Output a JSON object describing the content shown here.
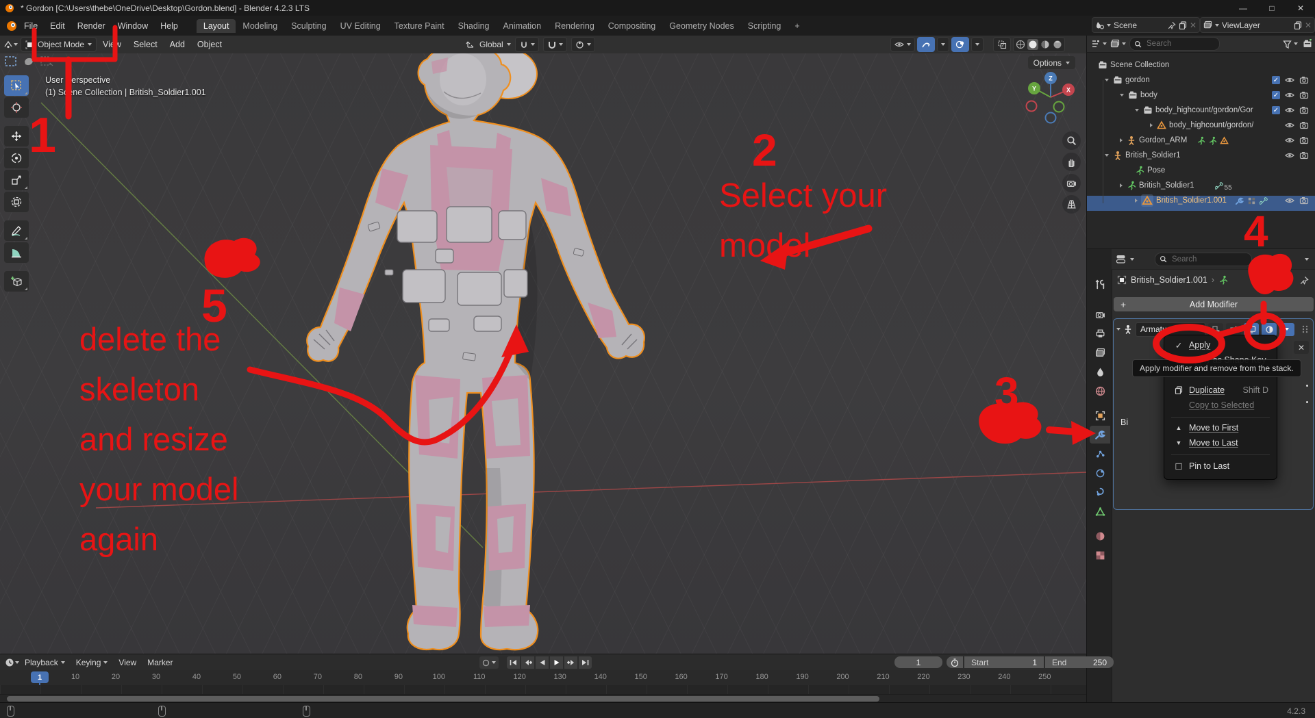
{
  "window": {
    "title": "* Gordon [C:\\Users\\thebe\\OneDrive\\Desktop\\Gordon.blend] - Blender 4.2.3 LTS",
    "minimize": "—",
    "maximize": "□",
    "close": "✕"
  },
  "menubar": {
    "menus": [
      "File",
      "Edit",
      "Render",
      "Window",
      "Help"
    ],
    "workspaces": [
      "Layout",
      "Modeling",
      "Sculpting",
      "UV Editing",
      "Texture Paint",
      "Shading",
      "Animation",
      "Rendering",
      "Compositing",
      "Geometry Nodes",
      "Scripting"
    ],
    "add_workspace": "+",
    "scene_value": "Scene",
    "viewlayer_value": "ViewLayer"
  },
  "viewport": {
    "mode": "Object Mode",
    "menus": [
      "View",
      "Select",
      "Add",
      "Object"
    ],
    "orientation": "Global",
    "options_label": "Options",
    "view_label": "User Perspective",
    "context_label": "(1) Scene Collection | British_Soldier1.001",
    "axis": {
      "x": "X",
      "y": "Y",
      "z": "Z"
    }
  },
  "outliner": {
    "search_placeholder": "Search",
    "rows": [
      {
        "label": "Scene Collection"
      },
      {
        "label": "gordon"
      },
      {
        "label": "body"
      },
      {
        "label": "body_highcount/gordon/Gor"
      },
      {
        "label": "body_highcount/gordon/"
      },
      {
        "label": "Gordon_ARM"
      },
      {
        "label": "British_Soldier1"
      },
      {
        "label": "Pose"
      },
      {
        "label": "British_Soldier1",
        "badge": "55"
      },
      {
        "label": "British_Soldier1.001"
      }
    ]
  },
  "properties": {
    "search_placeholder": "Search",
    "breadcrumb": "British_Soldier1.001",
    "add_modifier": "Add Modifier",
    "modifier_name": "Armature",
    "object_field_partial": "Bi",
    "close_glyph": "✕",
    "menu": {
      "apply": {
        "icon": "✓",
        "label": "Apply"
      },
      "apply_shape_key": {
        "label": "Apply as Shape Key"
      },
      "duplicate": {
        "label": "Duplicate",
        "shortcut": "Shift D"
      },
      "copy_to_selected": {
        "label": "Copy to Selected"
      },
      "move_first": {
        "icon": "▲",
        "label": "Move to First"
      },
      "move_last": {
        "icon": "▼",
        "label": "Move to Last"
      },
      "pin_last": {
        "icon": "☐",
        "label": "Pin to Last"
      }
    },
    "tooltip": "Apply modifier and remove from the stack."
  },
  "timeline": {
    "menus": [
      "Playback",
      "Keying",
      "View",
      "Marker"
    ],
    "current_frame": "1",
    "frame_badge": "1",
    "start_label": "Start",
    "start_value": "1",
    "end_label": "End",
    "end_value": "250",
    "ticks": [
      10,
      20,
      30,
      40,
      50,
      60,
      70,
      80,
      90,
      100,
      110,
      120,
      130,
      140,
      150,
      160,
      170,
      180,
      190,
      200,
      210,
      220,
      230,
      240,
      250
    ]
  },
  "statusbar": {
    "version": "4.2.3"
  },
  "annotations": {
    "color": "#e81414",
    "n1": "1",
    "n2": "2",
    "n3": "3",
    "n4": "4",
    "n5": "5",
    "select_line1": "Select your",
    "select_line2": "model",
    "delete_line1": "delete the",
    "delete_line2": "skeleton",
    "delete_line3": "and resize",
    "delete_line4": "your model",
    "delete_line5": "again"
  }
}
